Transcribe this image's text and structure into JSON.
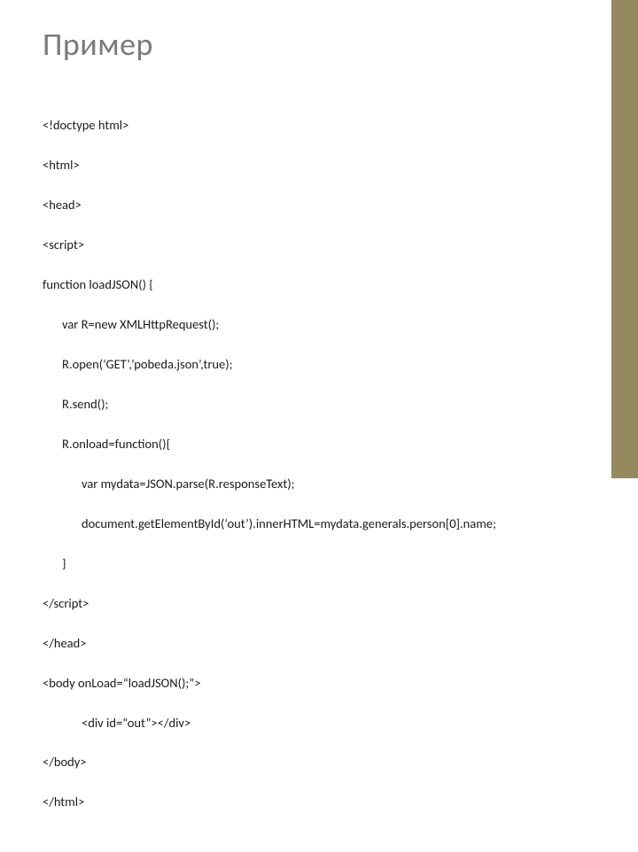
{
  "title": "Пример",
  "code": {
    "l01": "<!doctype html>",
    "l02": "<html>",
    "l03": "<head>",
    "l04": "<script>",
    "l05": "function loadJSON() {",
    "l06": "var R=new XMLHttpRequest();",
    "l07": "R.open(‘GET’,’pobeda.json’,true);",
    "l08": "R.send();",
    "l09": "R.onload=function(){",
    "l10": "var mydata=JSON.parse(R.responseText);",
    "l11": "document.getElementById(‘out’).innerHTML=mydata.generals.person[0].name;",
    "l12": "}",
    "l13": "</script>",
    "l14": "</head>",
    "l15": "<body onLoad=“loadJSON();”>",
    "l16": "<div id=“out”></div>",
    "l17": "</body>",
    "l18": "</html>"
  }
}
